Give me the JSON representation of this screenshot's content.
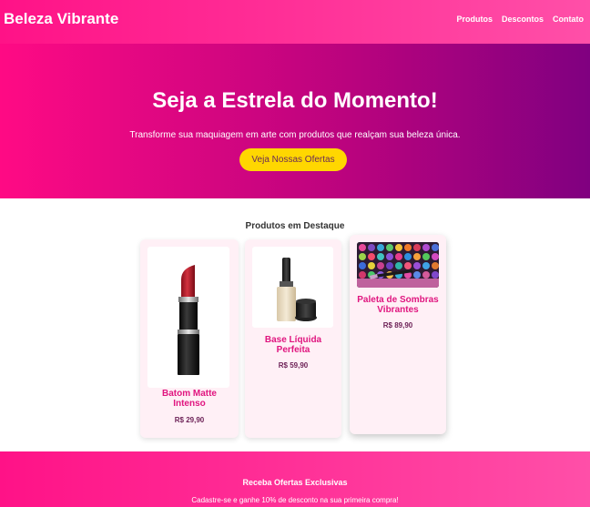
{
  "header": {
    "brand": "Beleza Vibrante",
    "nav": [
      "Produtos",
      "Descontos",
      "Contato"
    ]
  },
  "hero": {
    "title": "Seja a Estrela do Momento!",
    "subtitle": "Transforme sua maquiagem em arte com produtos que realçam sua beleza única.",
    "button": "Veja Nossas Ofertas"
  },
  "featured": {
    "title": "Produtos em Destaque",
    "products": [
      {
        "name_line1": "Batom Matte",
        "name_line2": "Intenso",
        "price": "R$ 29,90",
        "icon": "lipstick-icon"
      },
      {
        "name_line1": "Base Líquida",
        "name_line2": "Perfeita",
        "price": "R$ 59,90",
        "icon": "foundation-bottle-icon"
      },
      {
        "name_line1": "Paleta de Sombras",
        "name_line2": "Vibrantes",
        "price": "R$ 89,90",
        "icon": "eyeshadow-palette-icon"
      }
    ]
  },
  "footer": {
    "title": "Receba Ofertas Exclusivas",
    "subtitle": "Cadastre-se e ganhe 10% de desconto na sua primeira compra!"
  },
  "colors": {
    "primary": "#ff1287",
    "hero_end": "#800080",
    "button": "#ffd700",
    "product_name": "#e0157f"
  }
}
